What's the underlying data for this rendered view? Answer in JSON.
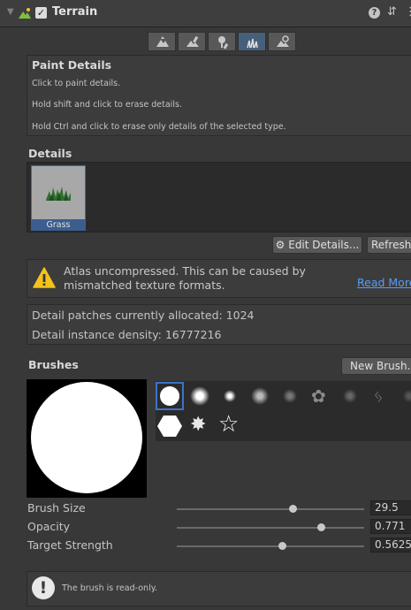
{
  "header": {
    "title": "Terrain",
    "enabled": true,
    "icons": [
      "fold-arrow-icon",
      "terrain-icon",
      "help-icon",
      "preset-icon",
      "menu-icon"
    ]
  },
  "toolbar": {
    "tools": [
      {
        "name": "raise-lower-icon"
      },
      {
        "name": "paint-texture-icon"
      },
      {
        "name": "paint-trees-icon"
      },
      {
        "name": "paint-details-icon",
        "selected": true
      },
      {
        "name": "terrain-settings-icon"
      }
    ]
  },
  "paint_details": {
    "title": "Paint Details",
    "lines": [
      "Click to paint details.",
      "Hold shift and click to erase details.",
      "Hold Ctrl and click to erase only details of the selected type."
    ]
  },
  "details": {
    "section_label": "Details",
    "items": [
      {
        "label": "Grass",
        "selected": true
      }
    ],
    "edit_details_label": "Edit Details...",
    "refresh_label": "Refresh"
  },
  "warning": {
    "text": "Atlas uncompressed. This can be caused by mismatched texture formats.",
    "link": "Read More"
  },
  "stats": {
    "patches": "Detail patches currently allocated: 1024",
    "density": "Detail instance density: 16777216"
  },
  "brushes": {
    "section_label": "Brushes",
    "new_brush_label": "New Brush...",
    "selected_index": 0
  },
  "sliders": [
    {
      "label": "Brush Size",
      "value": "29.5",
      "fraction": 0.62
    },
    {
      "label": "Opacity",
      "value": "0.771",
      "fraction": 0.77
    },
    {
      "label": "Target Strength",
      "value": "0.5625",
      "fraction": 0.56
    }
  ],
  "readonly_notice": {
    "text": "The brush is read-only."
  },
  "colors": {
    "background": "#383838",
    "accent": "#3c73c9",
    "link": "#589df6",
    "warning": "#f4c21b"
  }
}
